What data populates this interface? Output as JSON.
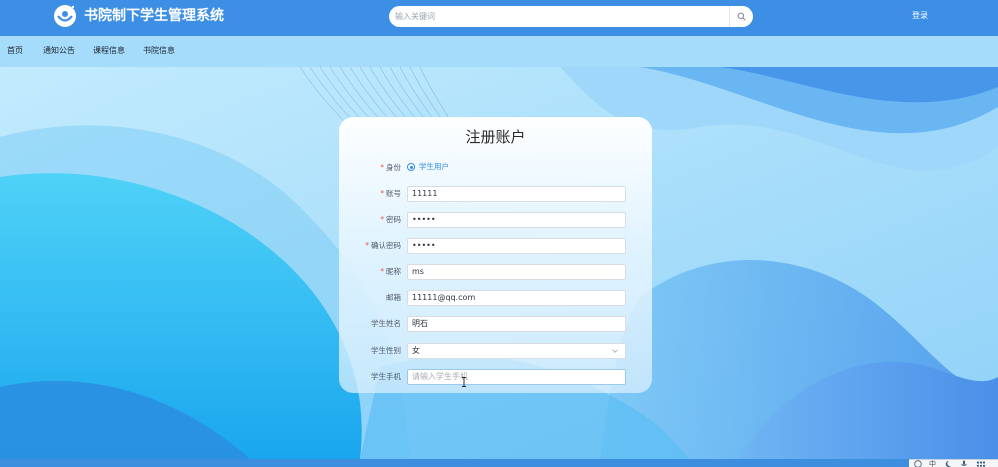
{
  "app": {
    "title": "书院制下学生管理系统",
    "login_label": "登录"
  },
  "search": {
    "placeholder": "输入关键词",
    "icon": "search-icon"
  },
  "nav": {
    "items": [
      "首页",
      "通知公告",
      "课程信息",
      "书院信息"
    ]
  },
  "form": {
    "title": "注册账户",
    "identity": {
      "label": "身份",
      "required": "*",
      "selected_option": "学生用户"
    },
    "account": {
      "label": "账号",
      "required": "*",
      "value": "11111"
    },
    "password": {
      "label": "密码",
      "required": "*",
      "value": "•••••"
    },
    "confirm_password": {
      "label": "确认密码",
      "required": "*",
      "value": "•••••"
    },
    "nickname": {
      "label": "昵称",
      "required": "*",
      "value": "ms"
    },
    "email": {
      "label": "邮箱",
      "value": "11111@qq.com"
    },
    "student_name": {
      "label": "学生姓名",
      "value": "明石"
    },
    "student_gender": {
      "label": "学生性别",
      "value": "女"
    },
    "student_phone": {
      "label": "学生手机",
      "placeholder": "请输入学生手机"
    }
  },
  "tray": {
    "items": [
      "中"
    ]
  },
  "colors": {
    "topbar": "#3d8fe6",
    "navbar": "#a6dcfb",
    "accent": "#2d8ce6",
    "required": "#e8594f"
  }
}
